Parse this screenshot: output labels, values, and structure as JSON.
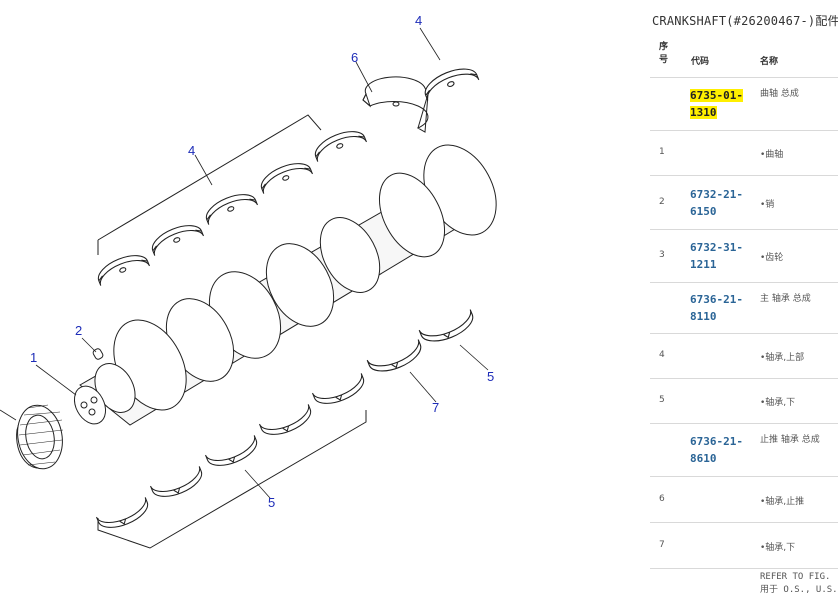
{
  "panel": {
    "title": "CRANKSHAFT(#26200467-)配件",
    "headers": {
      "seq": "序号",
      "code": "代码",
      "name": "名称"
    },
    "rows": [
      {
        "seq": "",
        "code": "6735-01-1310",
        "name": "曲轴 总成",
        "highlight": true
      },
      {
        "seq": "1",
        "code": "",
        "name": "•曲轴"
      },
      {
        "seq": "2",
        "code": "6732-21-6150",
        "name": "•销"
      },
      {
        "seq": "3",
        "code": "6732-31-1211",
        "name": "•齿轮"
      },
      {
        "seq": "",
        "code": "6736-21-8110",
        "name": "主 轴承 总成"
      },
      {
        "seq": "4",
        "code": "",
        "name": "•轴承,上部"
      },
      {
        "seq": "5",
        "code": "",
        "name": "•轴承,下"
      },
      {
        "seq": "",
        "code": "6736-21-8610",
        "name": "止推 轴承 总成"
      },
      {
        "seq": "6",
        "code": "",
        "name": "•轴承,止推"
      },
      {
        "seq": "7",
        "code": "",
        "name": "•轴承,下"
      }
    ],
    "footer": {
      "line1": "REFER TO FIG.",
      "line2": "用于 O.S., U.S."
    }
  },
  "diagram": {
    "callouts": {
      "upper_set": "4",
      "pin": "2",
      "crankshaft": "1",
      "thrust_top": "6",
      "upper_single": "4",
      "lower_right": "5",
      "thrust_bottom": "7",
      "lower_set": "5"
    },
    "line_color": "#222222",
    "callout_color": "#1d2cb8"
  },
  "colors": {
    "link": "#2a6496",
    "highlight": "#ffef00"
  }
}
